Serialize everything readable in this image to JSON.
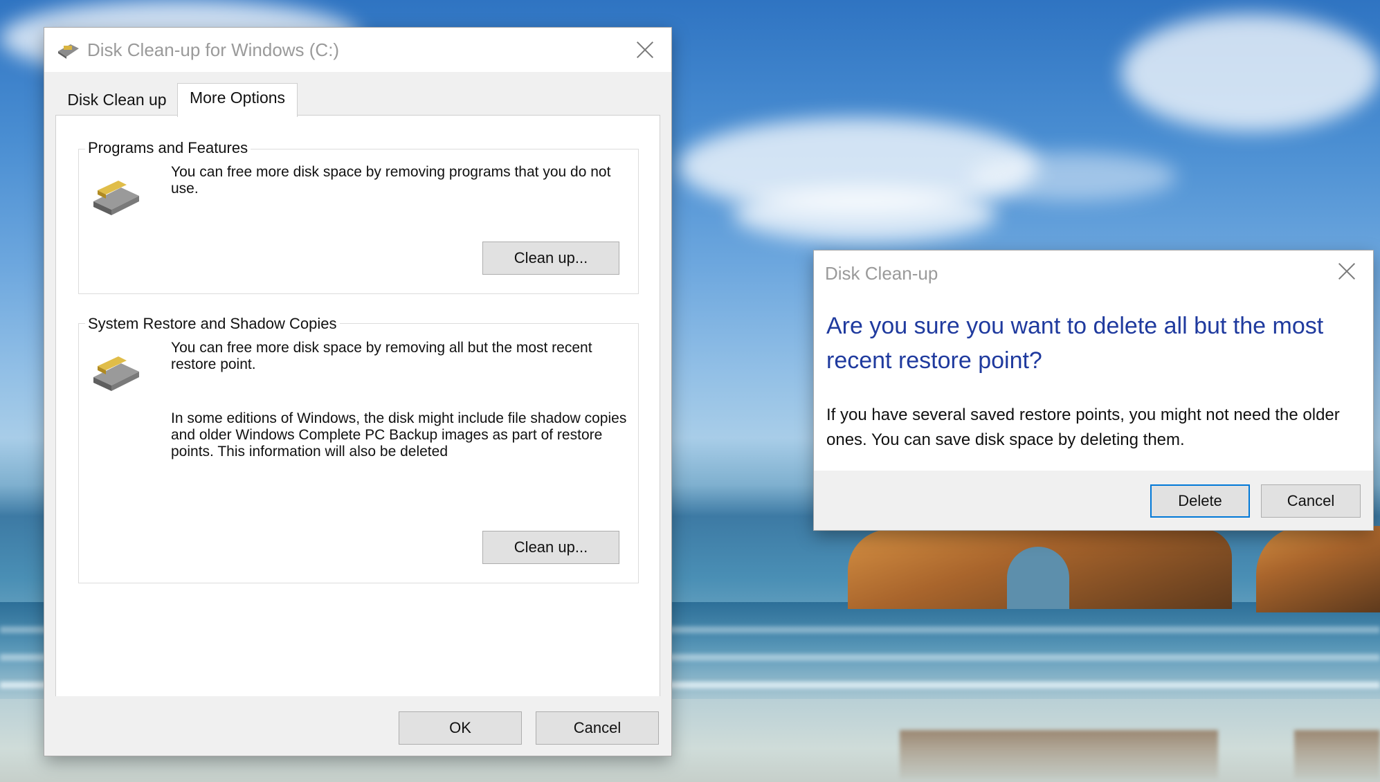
{
  "main_window": {
    "title": "Disk Clean-up for Windows (C:)",
    "tabs": [
      {
        "label": "Disk Clean up",
        "active": false
      },
      {
        "label": "More Options",
        "active": true
      }
    ],
    "programs_group": {
      "label": "Programs and Features",
      "description": "You can free more disk space by removing programs that you do not use.",
      "button_label": "Clean up..."
    },
    "restore_group": {
      "label": "System Restore and Shadow Copies",
      "description": "You can free more disk space by removing all but the most recent restore point.",
      "note": "In some editions of Windows, the disk might include file shadow copies and older Windows Complete PC Backup images as part of restore points. This information will also be deleted",
      "button_label": "Clean up..."
    },
    "ok_label": "OK",
    "cancel_label": "Cancel"
  },
  "confirm_dialog": {
    "title": "Disk Clean-up",
    "question": "Are you sure you want to delete all but the most recent restore point?",
    "detail": "If you have several saved restore points, you might not need the older ones. You can save disk space by deleting them.",
    "delete_label": "Delete",
    "cancel_label": "Cancel"
  },
  "icons": {
    "title_icon": "disk-cleanup-icon",
    "programs_icon": "drive-icon",
    "restore_icon": "drive-icon",
    "close_icon": "close-icon"
  },
  "colors": {
    "accent": "#0078d7",
    "question_text": "#1f3a9e"
  }
}
